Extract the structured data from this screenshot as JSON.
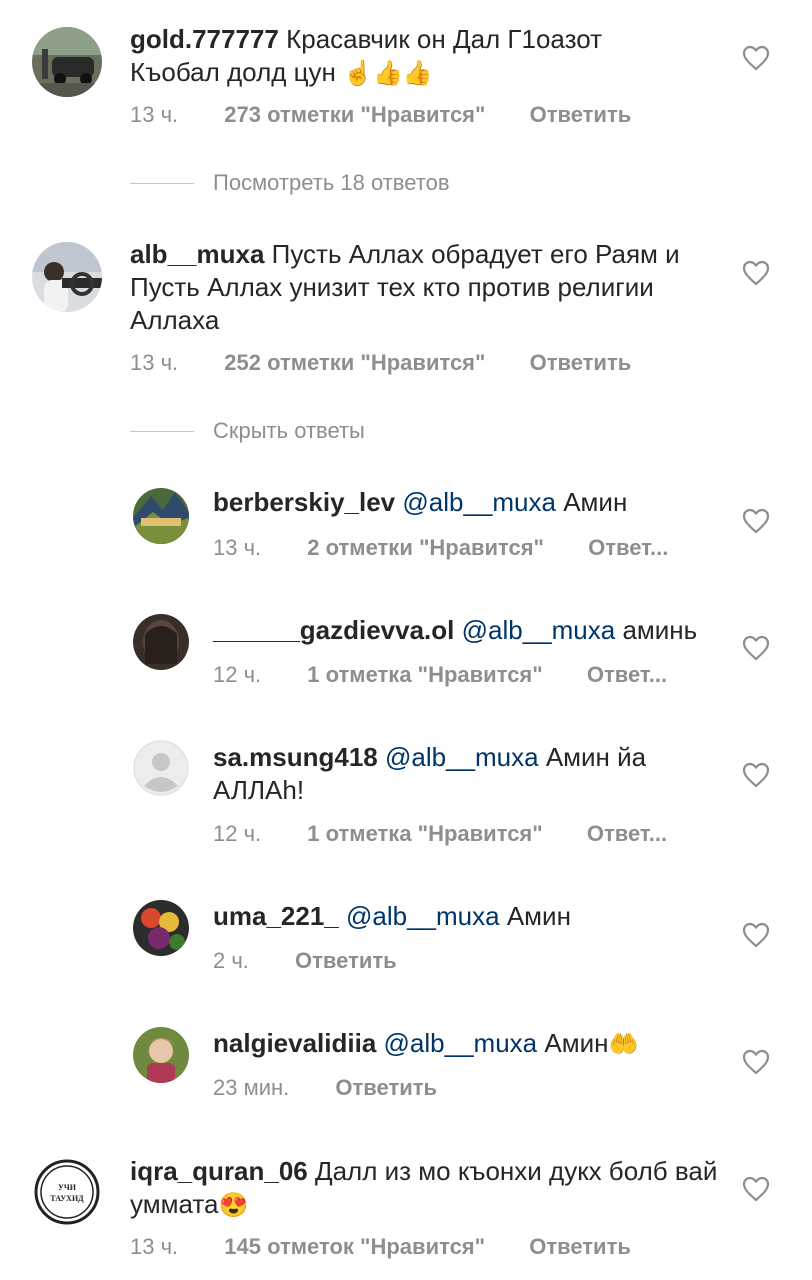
{
  "comments": [
    {
      "username": "gold.777777",
      "text": "Красавчик он Дал Г1оазот Къобал долд цун",
      "emoji": "☝👍👍",
      "time": "13 ч.",
      "likes": "273 отметки \"Нравится\"",
      "reply": "Ответить"
    },
    {
      "username": "alb__muxa",
      "text": "Пусть Аллах обрадует его Раям и Пусть  Аллах унизит тех кто против религии Аллаха",
      "time": "13 ч.",
      "likes": "252 отметки \"Нравится\"",
      "reply": "Ответить"
    },
    {
      "username": "iqra_quran_06",
      "text": "Далл из мо къонхи дукх болб вай уммата",
      "emoji": "😍",
      "time": "13 ч.",
      "likes": "145 отметок \"Нравится\"",
      "reply": "Ответить"
    }
  ],
  "view_replies": "Посмотреть 18 ответов",
  "hide_replies": "Скрыть ответы",
  "replies": [
    {
      "username": "berberskiy_lev",
      "mention": "@alb__muxa",
      "text": "Амин",
      "time": "13 ч.",
      "likes": "2 отметки \"Нравится\"",
      "reply": "Ответ..."
    },
    {
      "username": "______gazdievva.ol",
      "mention": "@alb__muxa",
      "text": "аминь",
      "time": "12 ч.",
      "likes": "1 отметка \"Нравится\"",
      "reply": "Ответ..."
    },
    {
      "username": "sa.msung418",
      "mention": "@alb__muxa",
      "text": "Амин йа АЛЛАh!",
      "time": "12 ч.",
      "likes": "1 отметка \"Нравится\"",
      "reply": "Ответ..."
    },
    {
      "username": "uma_221_",
      "mention": "@alb__muxa",
      "text": "Амин",
      "time": "2 ч.",
      "reply": "Ответить"
    },
    {
      "username": "nalgievalidiia",
      "mention": "@alb__muxa",
      "text": "Амин",
      "emoji": "🤲",
      "time": "23 мин.",
      "reply": "Ответить"
    }
  ],
  "avatar_stamp_text": "УЧИ ТАУХИД",
  "colors": {
    "text": "#262626",
    "secondary": "#8e8e8e",
    "mention": "#003569",
    "divider": "#c7c7c7"
  },
  "icons": {
    "like": "heart-outline-icon"
  }
}
